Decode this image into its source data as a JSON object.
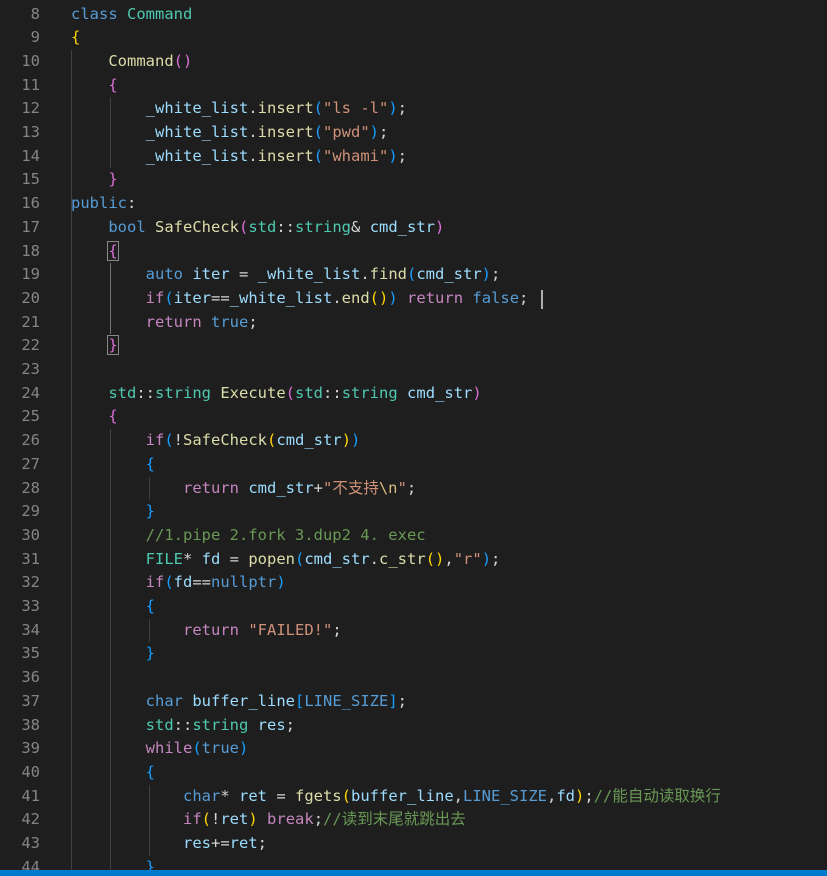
{
  "editor": {
    "first_line_number": 8,
    "colors": {
      "background": "#1e1e1e",
      "line_number": "#858585",
      "keyword": "#569cd6",
      "control": "#c586c0",
      "type": "#4ec9b0",
      "function": "#dcdcaa",
      "variable": "#9cdcfe",
      "string": "#ce9178",
      "comment": "#6a9955",
      "status_bar": "#007acc"
    },
    "lines": [
      [
        [
          "kw",
          "class"
        ],
        [
          "p",
          " "
        ],
        [
          "type",
          "Command"
        ]
      ],
      [
        [
          "b1",
          "{"
        ]
      ],
      [
        [
          "p",
          "    "
        ],
        [
          "fn",
          "Command"
        ],
        [
          "b2",
          "()"
        ]
      ],
      [
        [
          "p",
          "    "
        ],
        [
          "b2",
          "{"
        ]
      ],
      [
        [
          "p",
          "        "
        ],
        [
          "var",
          "_white_list"
        ],
        [
          "p",
          "."
        ],
        [
          "fn",
          "insert"
        ],
        [
          "b3",
          "("
        ],
        [
          "str",
          "\"ls -l\""
        ],
        [
          "b3",
          ")"
        ],
        [
          "p",
          ";"
        ]
      ],
      [
        [
          "p",
          "        "
        ],
        [
          "var",
          "_white_list"
        ],
        [
          "p",
          "."
        ],
        [
          "fn",
          "insert"
        ],
        [
          "b3",
          "("
        ],
        [
          "str",
          "\"pwd\""
        ],
        [
          "b3",
          ")"
        ],
        [
          "p",
          ";"
        ]
      ],
      [
        [
          "p",
          "        "
        ],
        [
          "var",
          "_white_list"
        ],
        [
          "p",
          "."
        ],
        [
          "fn",
          "insert"
        ],
        [
          "b3",
          "("
        ],
        [
          "str",
          "\"whami\""
        ],
        [
          "b3",
          ")"
        ],
        [
          "p",
          ";"
        ]
      ],
      [
        [
          "p",
          "    "
        ],
        [
          "b2",
          "}"
        ]
      ],
      [
        [
          "kw",
          "public"
        ],
        [
          "p",
          ":"
        ]
      ],
      [
        [
          "p",
          "    "
        ],
        [
          "kw",
          "bool"
        ],
        [
          "p",
          " "
        ],
        [
          "fn",
          "SafeCheck"
        ],
        [
          "b2",
          "("
        ],
        [
          "type",
          "std"
        ],
        [
          "p",
          "::"
        ],
        [
          "type",
          "string"
        ],
        [
          "p",
          "& "
        ],
        [
          "param",
          "cmd_str"
        ],
        [
          "b2",
          ")"
        ]
      ],
      [
        [
          "p",
          "    "
        ],
        [
          "b2m",
          "{"
        ]
      ],
      [
        [
          "p",
          "        "
        ],
        [
          "kw",
          "auto"
        ],
        [
          "p",
          " "
        ],
        [
          "var",
          "iter"
        ],
        [
          "p",
          " = "
        ],
        [
          "var",
          "_white_list"
        ],
        [
          "p",
          "."
        ],
        [
          "fn",
          "find"
        ],
        [
          "b3",
          "("
        ],
        [
          "param",
          "cmd_str"
        ],
        [
          "b3",
          ")"
        ],
        [
          "p",
          ";"
        ]
      ],
      [
        [
          "p",
          "        "
        ],
        [
          "ctrl",
          "if"
        ],
        [
          "b3",
          "("
        ],
        [
          "var",
          "iter"
        ],
        [
          "p",
          "=="
        ],
        [
          "var",
          "_white_list"
        ],
        [
          "p",
          "."
        ],
        [
          "fn",
          "end"
        ],
        [
          "b1",
          "()"
        ],
        [
          "b3",
          ")"
        ],
        [
          "p",
          " "
        ],
        [
          "ctrl",
          "return"
        ],
        [
          "p",
          " "
        ],
        [
          "kw",
          "false"
        ],
        [
          "p",
          ";"
        ]
      ],
      [
        [
          "p",
          "        "
        ],
        [
          "ctrl",
          "return"
        ],
        [
          "p",
          " "
        ],
        [
          "kw",
          "true"
        ],
        [
          "p",
          ";"
        ]
      ],
      [
        [
          "p",
          "    "
        ],
        [
          "b2m",
          "}"
        ]
      ],
      [],
      [
        [
          "p",
          "    "
        ],
        [
          "type",
          "std"
        ],
        [
          "p",
          "::"
        ],
        [
          "type",
          "string"
        ],
        [
          "p",
          " "
        ],
        [
          "fn",
          "Execute"
        ],
        [
          "b2",
          "("
        ],
        [
          "type",
          "std"
        ],
        [
          "p",
          "::"
        ],
        [
          "type",
          "string"
        ],
        [
          "p",
          " "
        ],
        [
          "param",
          "cmd_str"
        ],
        [
          "b2",
          ")"
        ]
      ],
      [
        [
          "p",
          "    "
        ],
        [
          "b2",
          "{"
        ]
      ],
      [
        [
          "p",
          "        "
        ],
        [
          "ctrl",
          "if"
        ],
        [
          "b3",
          "("
        ],
        [
          "p",
          "!"
        ],
        [
          "fn",
          "SafeCheck"
        ],
        [
          "b1",
          "("
        ],
        [
          "param",
          "cmd_str"
        ],
        [
          "b1",
          ")"
        ],
        [
          "b3",
          ")"
        ]
      ],
      [
        [
          "p",
          "        "
        ],
        [
          "b3",
          "{"
        ]
      ],
      [
        [
          "p",
          "            "
        ],
        [
          "ctrl",
          "return"
        ],
        [
          "p",
          " "
        ],
        [
          "param",
          "cmd_str"
        ],
        [
          "p",
          "+"
        ],
        [
          "str",
          "\"不支持"
        ],
        [
          "esc",
          "\\n"
        ],
        [
          "str",
          "\""
        ],
        [
          "p",
          ";"
        ]
      ],
      [
        [
          "p",
          "        "
        ],
        [
          "b3",
          "}"
        ]
      ],
      [
        [
          "p",
          "        "
        ],
        [
          "cmt",
          "//1.pipe 2.fork 3.dup2 4. exec"
        ]
      ],
      [
        [
          "p",
          "        "
        ],
        [
          "type",
          "FILE"
        ],
        [
          "p",
          "* "
        ],
        [
          "var",
          "fd"
        ],
        [
          "p",
          " = "
        ],
        [
          "fn",
          "popen"
        ],
        [
          "b3",
          "("
        ],
        [
          "param",
          "cmd_str"
        ],
        [
          "p",
          "."
        ],
        [
          "fn",
          "c_str"
        ],
        [
          "b1",
          "()"
        ],
        [
          "p",
          ","
        ],
        [
          "str",
          "\"r\""
        ],
        [
          "b3",
          ")"
        ],
        [
          "p",
          ";"
        ]
      ],
      [
        [
          "p",
          "        "
        ],
        [
          "ctrl",
          "if"
        ],
        [
          "b3",
          "("
        ],
        [
          "var",
          "fd"
        ],
        [
          "p",
          "=="
        ],
        [
          "kw",
          "nullptr"
        ],
        [
          "b3",
          ")"
        ]
      ],
      [
        [
          "p",
          "        "
        ],
        [
          "b3",
          "{"
        ]
      ],
      [
        [
          "p",
          "            "
        ],
        [
          "ctrl",
          "return"
        ],
        [
          "p",
          " "
        ],
        [
          "str",
          "\"FAILED!\""
        ],
        [
          "p",
          ";"
        ]
      ],
      [
        [
          "p",
          "        "
        ],
        [
          "b3",
          "}"
        ]
      ],
      [],
      [
        [
          "p",
          "        "
        ],
        [
          "kw",
          "char"
        ],
        [
          "p",
          " "
        ],
        [
          "var",
          "buffer_line"
        ],
        [
          "b3",
          "["
        ],
        [
          "macro",
          "LINE_SIZE"
        ],
        [
          "b3",
          "]"
        ],
        [
          "p",
          ";"
        ]
      ],
      [
        [
          "p",
          "        "
        ],
        [
          "type",
          "std"
        ],
        [
          "p",
          "::"
        ],
        [
          "type",
          "string"
        ],
        [
          "p",
          " "
        ],
        [
          "var",
          "res"
        ],
        [
          "p",
          ";"
        ]
      ],
      [
        [
          "p",
          "        "
        ],
        [
          "ctrl",
          "while"
        ],
        [
          "b3",
          "("
        ],
        [
          "kw",
          "true"
        ],
        [
          "b3",
          ")"
        ]
      ],
      [
        [
          "p",
          "        "
        ],
        [
          "b3",
          "{"
        ]
      ],
      [
        [
          "p",
          "            "
        ],
        [
          "kw",
          "char"
        ],
        [
          "p",
          "* "
        ],
        [
          "var",
          "ret"
        ],
        [
          "p",
          " = "
        ],
        [
          "fn",
          "fgets"
        ],
        [
          "b1",
          "("
        ],
        [
          "var",
          "buffer_line"
        ],
        [
          "p",
          ","
        ],
        [
          "macro",
          "LINE_SIZE"
        ],
        [
          "p",
          ","
        ],
        [
          "var",
          "fd"
        ],
        [
          "b1",
          ")"
        ],
        [
          "p",
          ";"
        ],
        [
          "cmt",
          "//能自动读取换行"
        ]
      ],
      [
        [
          "p",
          "            "
        ],
        [
          "ctrl",
          "if"
        ],
        [
          "b1",
          "("
        ],
        [
          "p",
          "!"
        ],
        [
          "var",
          "ret"
        ],
        [
          "b1",
          ")"
        ],
        [
          "p",
          " "
        ],
        [
          "ctrl",
          "break"
        ],
        [
          "p",
          ";"
        ],
        [
          "cmt",
          "//读到末尾就跳出去"
        ]
      ],
      [
        [
          "p",
          "            "
        ],
        [
          "var",
          "res"
        ],
        [
          "p",
          "+="
        ],
        [
          "var",
          "ret"
        ],
        [
          "p",
          ";"
        ]
      ],
      [
        [
          "p",
          "        "
        ],
        [
          "b3",
          "}"
        ]
      ]
    ]
  }
}
